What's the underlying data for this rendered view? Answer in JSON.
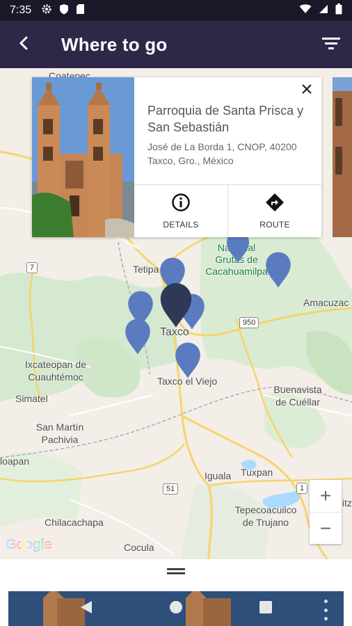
{
  "status_bar": {
    "time": "7:35",
    "left_icons": [
      "gear-icon",
      "shield-icon",
      "sd-card-icon"
    ],
    "right_icons": [
      "wifi-icon",
      "signal-icon",
      "battery-icon"
    ]
  },
  "app_bar": {
    "title": "Where to go",
    "back_icon": "back-arrow-icon",
    "filter_icon": "filter-icon"
  },
  "map": {
    "places": [
      {
        "name": "Coatepec",
        "label": "Coatepec"
      },
      {
        "name": "Tetipac",
        "label": "Tetipa"
      },
      {
        "name": "Parque Nacional Grutas de Cacahuamilpa",
        "label": "Nacional\nGrutas de\nCacahuamilpa"
      },
      {
        "name": "Amacuzac",
        "label": "Amacuzac"
      },
      {
        "name": "Taxco",
        "label": "Taxco"
      },
      {
        "name": "Taxco el Viejo",
        "label": "Taxco el Viejo"
      },
      {
        "name": "Ixcateopan de Cuauhtémoc",
        "label": "Ixcateopan de\nCuauhtémoc"
      },
      {
        "name": "Simatel",
        "label": "Simatel"
      },
      {
        "name": "Buenavista de Cuéllar",
        "label": "Buenavista\nde Cuéllar"
      },
      {
        "name": "San Martín Pachivia",
        "label": "San Martín\nPachivia"
      },
      {
        "name": "Noapan",
        "label": "loapan"
      },
      {
        "name": "Iguala",
        "label": "Iguala"
      },
      {
        "name": "Tuxpan",
        "label": "Tuxpan"
      },
      {
        "name": "Tepecoacuilco de Trujano",
        "label": "Tepecoacuilco\nde Trujano"
      },
      {
        "name": "Chilacachapa",
        "label": "Chilacachapa"
      },
      {
        "name": "Cocula",
        "label": "Cocula"
      },
      {
        "name": "Huitz",
        "label": "Huitz"
      }
    ],
    "route_shields": [
      "7",
      "950",
      "51",
      "1"
    ],
    "pin_colors": {
      "default": "#5a7bbf",
      "selected": "#2e3a55"
    },
    "google_logo": "Google"
  },
  "info_card": {
    "name": "Parroquia de Santa Prisca y San Sebastián",
    "address": "José de La Borda 1, CNOP, 40200 Taxco, Gro., México",
    "details_label": "DETAILS",
    "route_label": "ROUTE",
    "close_icon": "close-icon",
    "details_icon": "info-icon",
    "route_icon": "directions-icon"
  },
  "zoom": {
    "in_label": "+",
    "out_label": "−"
  },
  "bottom_sheet": {
    "handle_icon": "drag-handle-icon"
  },
  "nav_bar": {
    "back": "nav-back-icon",
    "home": "nav-home-icon",
    "recents": "nav-recents-icon",
    "more": "more-vert-icon"
  }
}
